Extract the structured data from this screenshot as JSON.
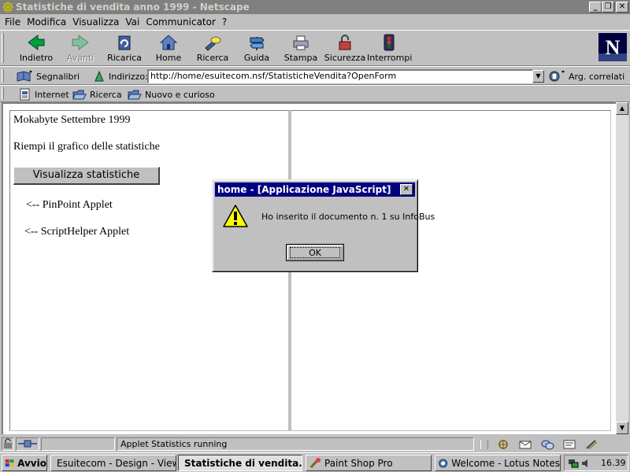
{
  "window": {
    "title": "Statistiche di vendita anno 1999 - Netscape"
  },
  "menu": {
    "file": "File",
    "modifica": "Modifica",
    "visualizza": "Visualizza",
    "vai": "Vai",
    "communicator": "Communicator",
    "help": "?"
  },
  "toolbar": {
    "buttons": [
      {
        "label": "Indietro"
      },
      {
        "label": "Avanti"
      },
      {
        "label": "Ricarica"
      },
      {
        "label": "Home"
      },
      {
        "label": "Ricerca"
      },
      {
        "label": "Guida"
      },
      {
        "label": "Stampa"
      },
      {
        "label": "Sicurezza"
      },
      {
        "label": "Interrompi"
      }
    ]
  },
  "location": {
    "bookmarks_label": "Segnalibri",
    "address_label": "Indirizzo:",
    "url": "http://home/esuitecom.nsf/StatisticheVendita?OpenForm",
    "related_label": "Arg. correlati"
  },
  "personal": {
    "items": [
      "Internet",
      "Ricerca",
      "Nuovo e curioso"
    ]
  },
  "page": {
    "header": "Mokabyte Settembre 1999",
    "subtitle": "Riempi il grafico delle statistiche",
    "button": "Visualizza statistiche",
    "applet1": "<-- PinPoint Applet",
    "applet2": "<-- ScriptHelper Applet"
  },
  "dialog": {
    "title": "home - [Applicazione JavaScript]",
    "message": "Ho inserito il documento n. 1 su InfoBus",
    "ok": "OK"
  },
  "status": {
    "text": "Applet Statistics running"
  },
  "taskbar": {
    "start": "Avvio",
    "tasks": [
      "Esuitecom - Design - View...",
      "Statistiche di vendita...",
      "Paint Shop Pro",
      "Welcome - Lotus Notes"
    ],
    "clock": "16.39"
  }
}
